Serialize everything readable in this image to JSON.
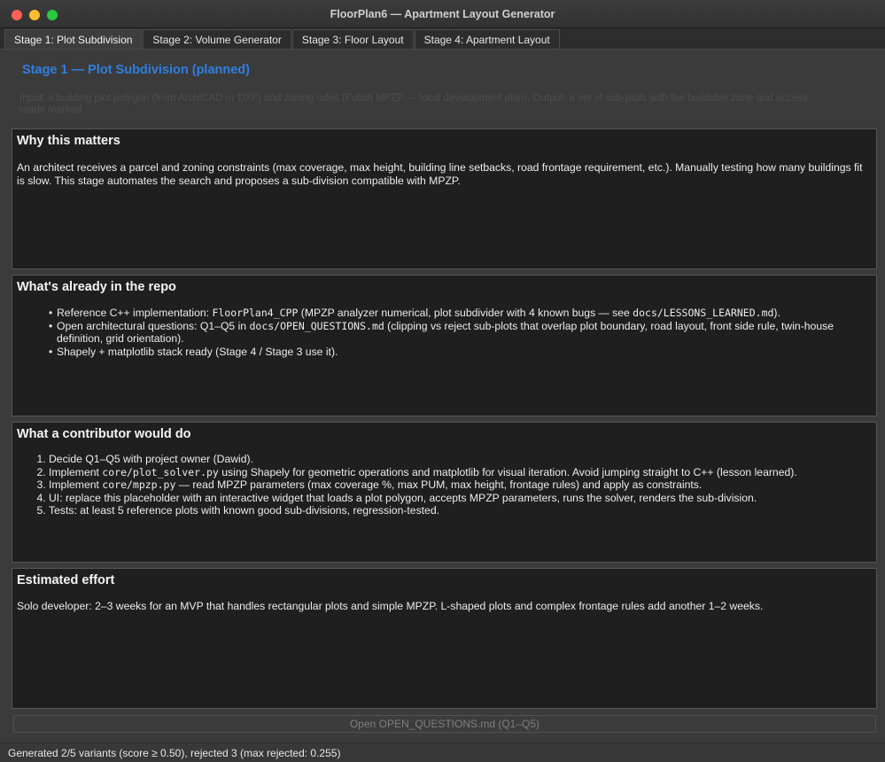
{
  "window": {
    "title": "FloorPlan6 — Apartment Layout Generator"
  },
  "tabs": [
    {
      "label": "Stage 1: Plot Subdivision",
      "active": true
    },
    {
      "label": "Stage 2: Volume Generator",
      "active": false
    },
    {
      "label": "Stage 3: Floor Layout",
      "active": false
    },
    {
      "label": "Stage 4: Apartment Layout",
      "active": false
    }
  ],
  "stage": {
    "heading": "Stage 1 — Plot Subdivision (planned)",
    "description_line1": "Input: a building plot polygon (from ArchiCAD or DXF) and zoning rules (Polish MPZP — local development plan). Output: a set of sub-plots with the buildable zone and access",
    "description_line2": "roads marked."
  },
  "sections": {
    "why": {
      "title": "Why this matters",
      "body": "An architect receives a parcel and zoning constraints (max coverage, max height, building line setbacks, road frontage requirement, etc.). Manually testing how many buildings fit is slow. This stage automates the search and proposes a sub-division compatible with MPZP."
    },
    "repo": {
      "title": "What's already in the repo",
      "items": [
        {
          "pre": "Reference C++ implementation: ",
          "code1": "FloorPlan4_CPP",
          "mid": " (MPZP analyzer numerical, plot subdivider with 4 known bugs — see ",
          "code2": "docs/LESSONS_LEARNED.md",
          "post": ")."
        },
        {
          "pre": "Open architectural questions: Q1–Q5 in ",
          "code1": "docs/OPEN_QUESTIONS.md",
          "mid": " (clipping vs reject sub-plots that overlap plot boundary, road layout, front side rule, twin-house definition, grid orientation).",
          "code2": "",
          "post": ""
        },
        {
          "pre": "Shapely + matplotlib stack ready (Stage 4 / Stage 3 use it).",
          "code1": "",
          "mid": "",
          "code2": "",
          "post": ""
        }
      ]
    },
    "contrib": {
      "title": "What a contributor would do",
      "items": [
        {
          "pre": "Decide Q1–Q5 with project owner (Dawid).",
          "code": "",
          "post": ""
        },
        {
          "pre": "Implement ",
          "code": "core/plot_solver.py",
          "post": " using Shapely for geometric operations and matplotlib for visual iteration. Avoid jumping straight to C++ (lesson learned)."
        },
        {
          "pre": "Implement ",
          "code": "core/mpzp.py",
          "post": " — read MPZP parameters (max coverage %, max PUM, max height, frontage rules) and apply as constraints."
        },
        {
          "pre": "UI: replace this placeholder with an interactive widget that loads a plot polygon, accepts MPZP parameters, runs the solver, renders the sub-division.",
          "code": "",
          "post": ""
        },
        {
          "pre": "Tests: at least 5 reference plots with known good sub-divisions, regression-tested.",
          "code": "",
          "post": ""
        }
      ]
    },
    "effort": {
      "title": "Estimated effort",
      "body": "Solo developer: 2–3 weeks for an MVP that handles rectangular plots and simple MPZP. L-shaped plots and complex frontage rules add another 1–2 weeks."
    }
  },
  "open_button": {
    "label": "Open OPEN_QUESTIONS.md (Q1–Q5)"
  },
  "status": {
    "text": "Generated 2/5 variants (score ≥ 0.50), rejected 3 (max rejected: 0.255)"
  }
}
